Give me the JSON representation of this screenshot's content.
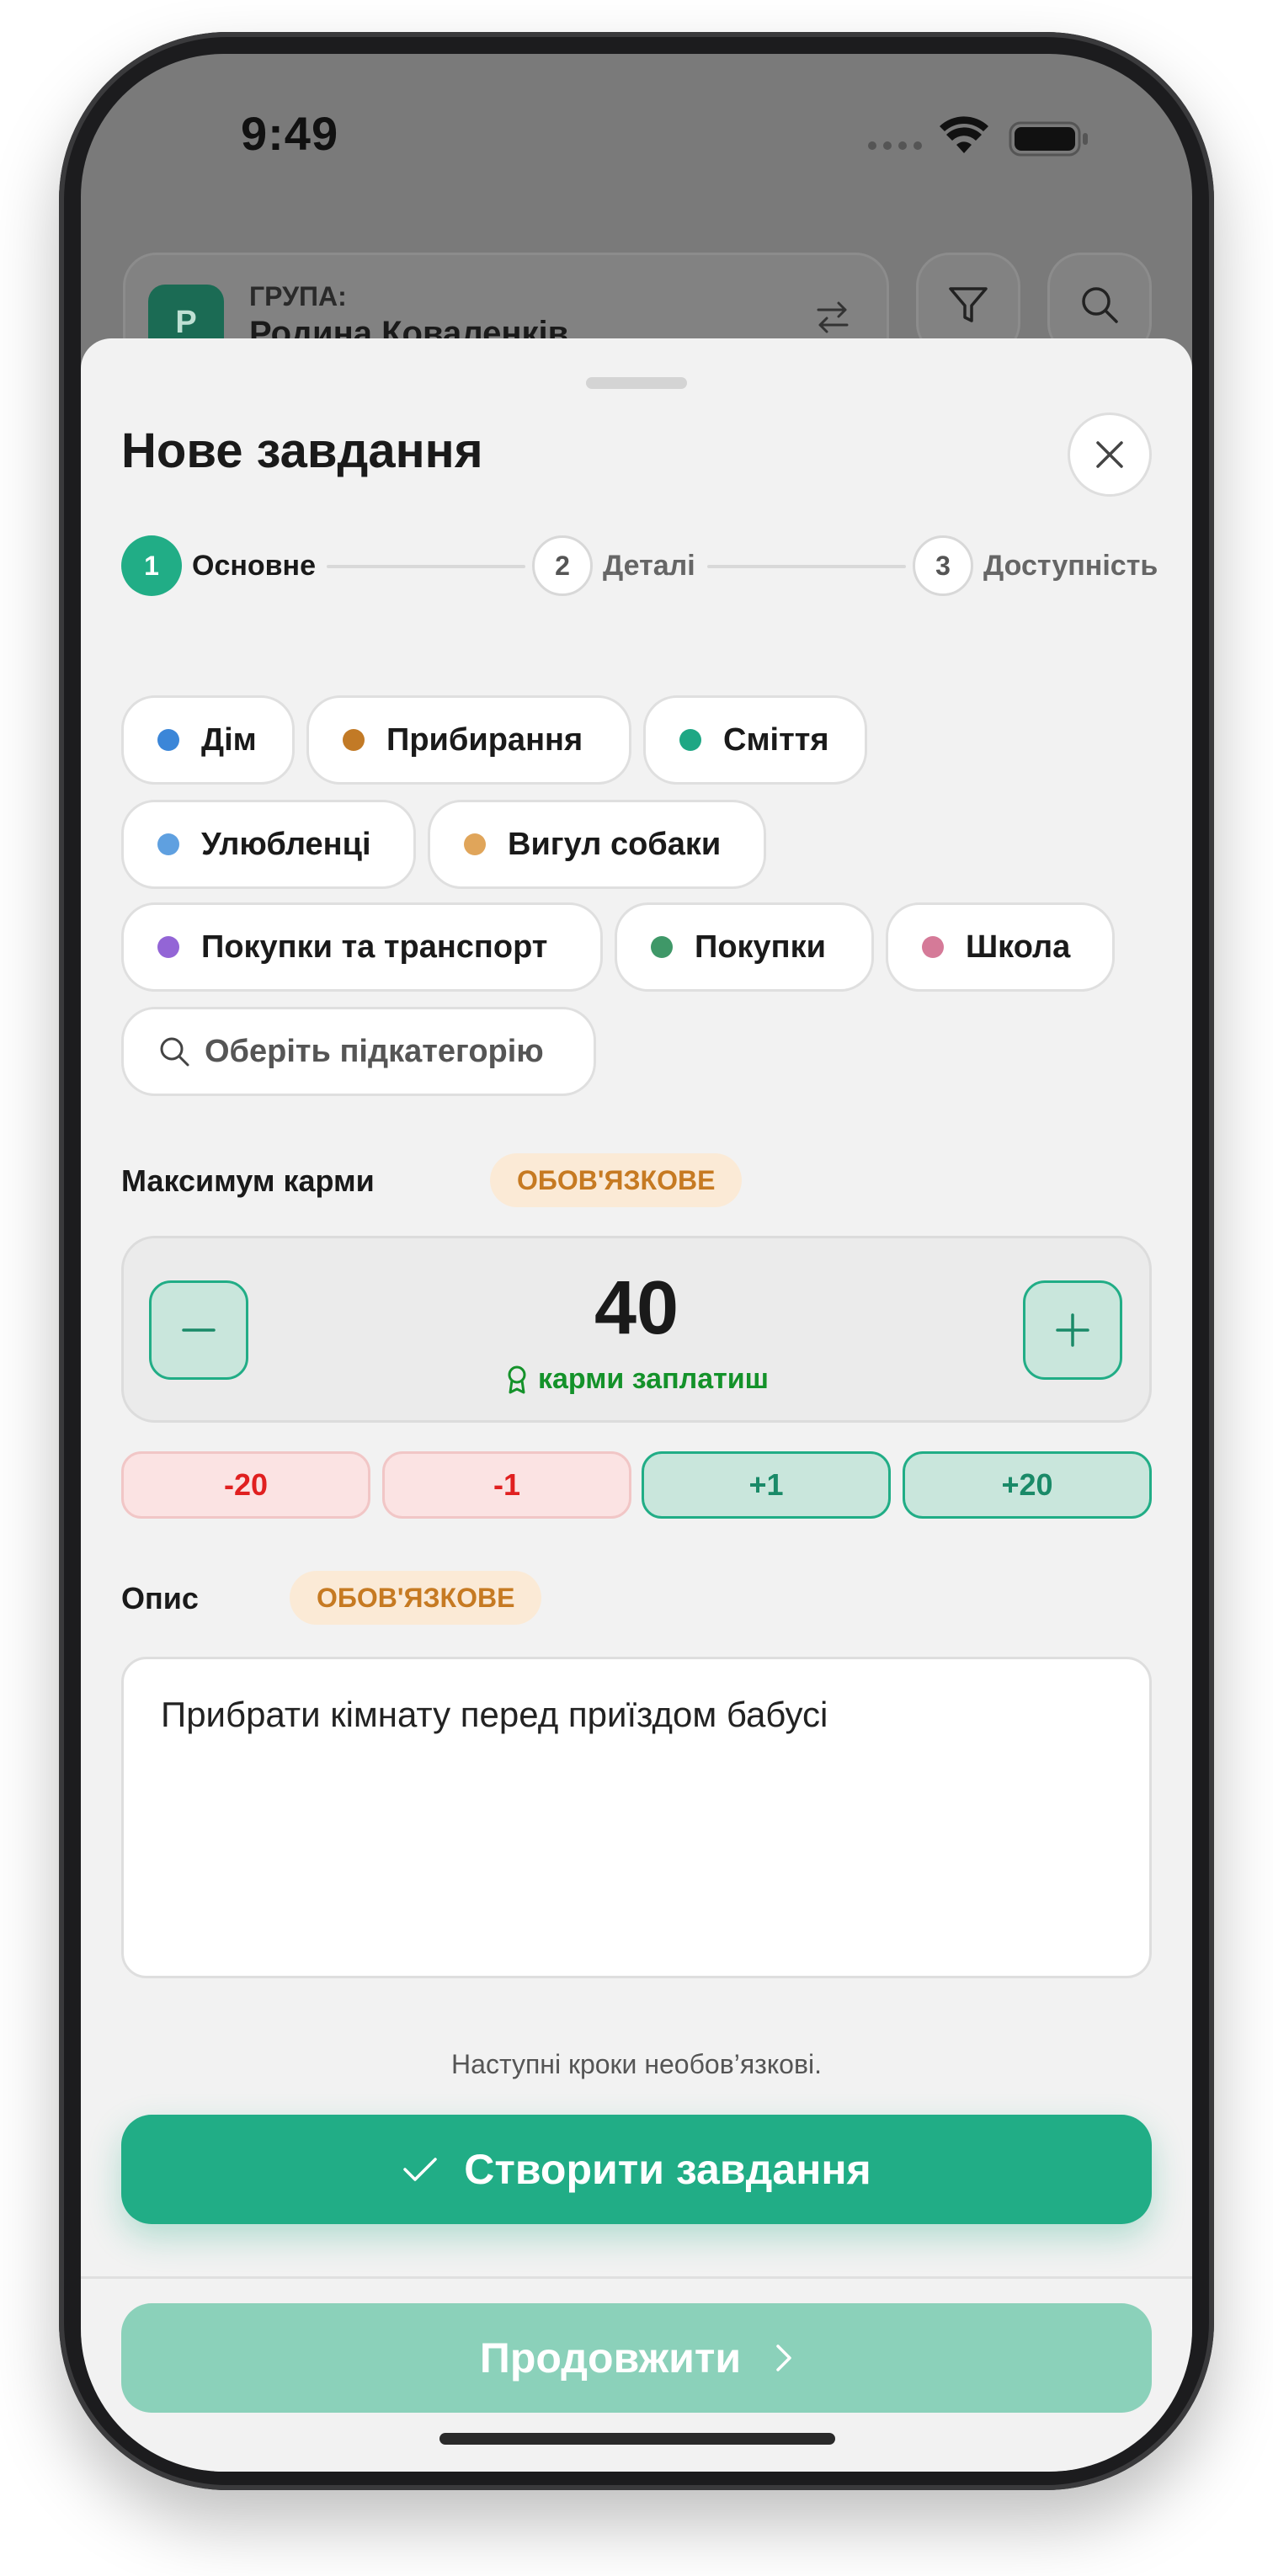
{
  "status_bar": {
    "time": "9:49"
  },
  "background": {
    "group_label": "ГРУПА:",
    "group_name": "Родина Коваленків",
    "group_initial": "Р"
  },
  "sheet": {
    "title": "Нове завдання",
    "steps": [
      {
        "number": "1",
        "label": "Основне",
        "active": true
      },
      {
        "number": "2",
        "label": "Деталі",
        "active": false
      },
      {
        "number": "3",
        "label": "Доступність",
        "active": false
      }
    ],
    "categories": [
      {
        "label": "Дім",
        "color": "#3b86d8"
      },
      {
        "label": "Прибирання",
        "color": "#c27a26"
      },
      {
        "label": "Сміття",
        "color": "#1ea784"
      },
      {
        "label": "Улюбленці",
        "color": "#5fa0e0"
      },
      {
        "label": "Вигул собаки",
        "color": "#e0a55a"
      },
      {
        "label": "Покупки та транспорт",
        "color": "#9365d6"
      },
      {
        "label": "Покупки",
        "color": "#3f9868"
      },
      {
        "label": "Школа",
        "color": "#d57a98"
      }
    ],
    "subcategory_placeholder": "Оберіть підкатегорію",
    "karma": {
      "label": "Максимум карми",
      "badge": "ОБОВ'ЯЗКОВЕ",
      "value": "40",
      "caption": "карми заплатиш",
      "quick": [
        "-20",
        "-1",
        "+1",
        "+20"
      ]
    },
    "description": {
      "label": "Опис",
      "badge": "ОБОВ'ЯЗКОВЕ",
      "value": "Прибрати кімнату перед приїздом бабусі"
    },
    "hint": "Наступні кроки необов’язкові.",
    "create_label": "Створити завдання",
    "continue_label": "Продовжити"
  },
  "colors": {
    "accent": "#21ad86",
    "accent_light": "#8bd1ba",
    "warning": "#c67a22",
    "danger": "#e02020"
  }
}
